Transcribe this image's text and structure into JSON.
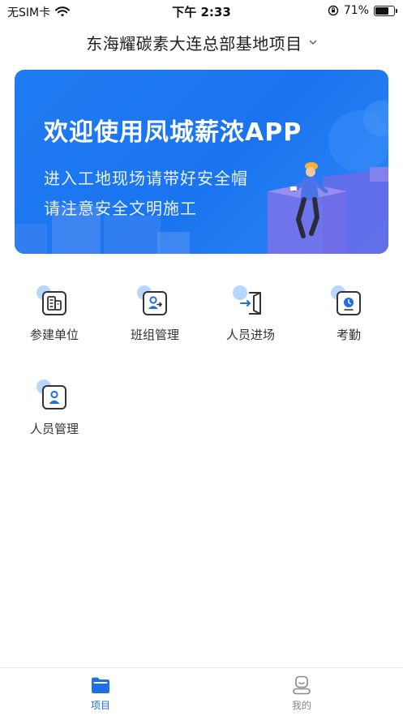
{
  "status_bar": {
    "carrier": "无SIM卡",
    "time": "下午 2:33",
    "battery": "71%",
    "battery_level": 0.71
  },
  "header": {
    "project_name": "东海耀碳素大连总部基地项目"
  },
  "banner": {
    "title": "欢迎使用凤城薪浓APP",
    "line1": "进入工地现场请带好安全帽",
    "line2": "请注意安全文明施工"
  },
  "menu": [
    {
      "label": "参建单位",
      "icon": "building-units-icon"
    },
    {
      "label": "班组管理",
      "icon": "team-management-icon"
    },
    {
      "label": "人员进场",
      "icon": "personnel-entry-icon"
    },
    {
      "label": "考勤",
      "icon": "attendance-clock-icon"
    },
    {
      "label": "人员管理",
      "icon": "personnel-management-icon"
    }
  ],
  "tabbar": {
    "tabs": [
      {
        "label": "项目",
        "icon": "folder-icon",
        "active": true
      },
      {
        "label": "我的",
        "icon": "profile-icon",
        "active": false
      }
    ]
  },
  "colors": {
    "accent": "#1e6ee8",
    "banner_blue": "#1f7bf2",
    "icon_blob": "#b8d7ff"
  }
}
